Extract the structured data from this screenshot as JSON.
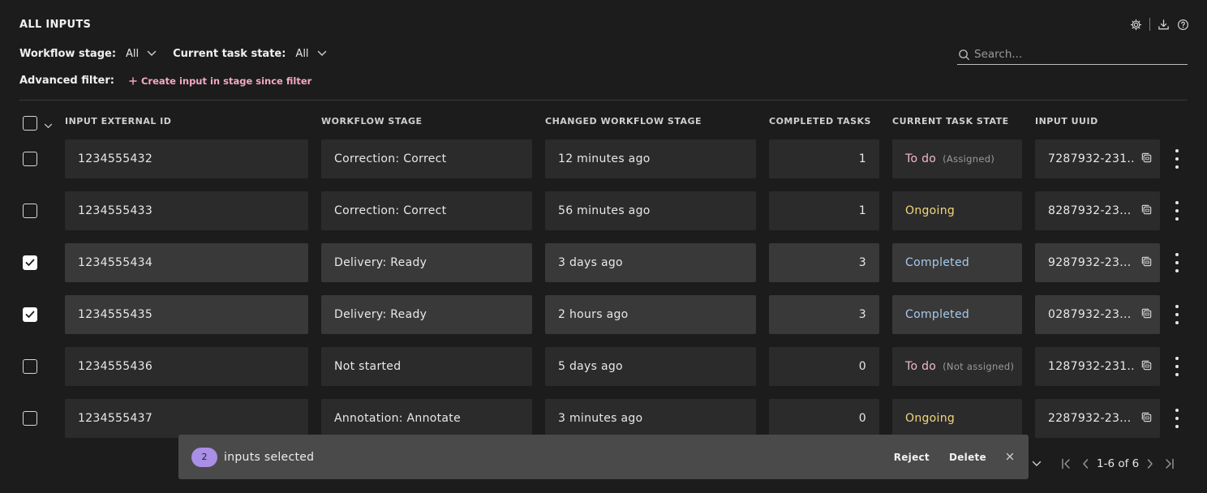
{
  "header": {
    "title": "ALL INPUTS",
    "icons": [
      "gear-icon",
      "download-icon",
      "help-icon"
    ]
  },
  "filters": {
    "workflow_stage_label": "Workflow stage:",
    "workflow_stage_value": "All",
    "task_state_label": "Current task state:",
    "task_state_value": "All",
    "advanced_label": "Advanced filter:",
    "create_link": "Create input in stage since filter"
  },
  "search": {
    "placeholder": "Search..."
  },
  "table": {
    "columns": [
      "INPUT EXTERNAL ID",
      "WORKFLOW STAGE",
      "CHANGED WORKFLOW STAGE",
      "COMPLETED TASKS",
      "CURRENT TASK STATE",
      "INPUT UUID"
    ],
    "rows": [
      {
        "id": "1234555432",
        "stage": "Correction: Correct",
        "changed": "12 minutes ago",
        "completed": "1",
        "state": "To do",
        "state_sub": "(Assigned)",
        "uuid": "7287932-231...",
        "checked": false
      },
      {
        "id": "1234555433",
        "stage": "Correction: Correct",
        "changed": "56 minutes ago",
        "completed": "1",
        "state": "Ongoing",
        "state_sub": "",
        "uuid": "8287932-23...",
        "checked": false
      },
      {
        "id": "1234555434",
        "stage": "Delivery: Ready",
        "changed": "3 days ago",
        "completed": "3",
        "state": "Completed",
        "state_sub": "",
        "uuid": "9287932-23...",
        "checked": true
      },
      {
        "id": "1234555435",
        "stage": "Delivery: Ready",
        "changed": "2 hours ago",
        "completed": "3",
        "state": "Completed",
        "state_sub": "",
        "uuid": "0287932-23...",
        "checked": true
      },
      {
        "id": "1234555436",
        "stage": "Not started",
        "changed": "5 days ago",
        "completed": "0",
        "state": "To do",
        "state_sub": "(Not assigned)",
        "uuid": "1287932-231...",
        "checked": false
      },
      {
        "id": "1234555437",
        "stage": "Annotation: Annotate",
        "changed": "3 minutes ago",
        "completed": "0",
        "state": "Ongoing",
        "state_sub": "",
        "uuid": "2287932-23...",
        "checked": false
      }
    ]
  },
  "selection_bar": {
    "count": "2",
    "text": "inputs selected",
    "reject_label": "Reject",
    "delete_label": "Delete"
  },
  "pagination": {
    "range": "1-6 of 6"
  },
  "colors": {
    "background": "#1c1c1d",
    "cell": "#2b2b2c",
    "cell_selected": "#393939",
    "todo": "#f2b8cf",
    "ongoing": "#f3d77a",
    "completed": "#a8c9ec",
    "badge": "#a98fe6",
    "link": "#f4a7c4"
  }
}
